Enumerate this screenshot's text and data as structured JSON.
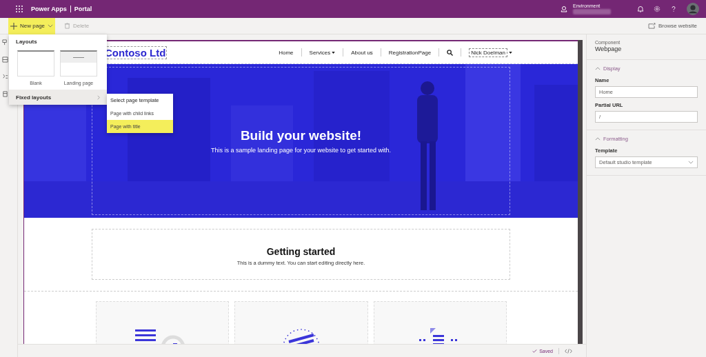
{
  "app_bar": {
    "title": "Power Apps",
    "section": "Portal",
    "environment_label": "Environment"
  },
  "toolbar": {
    "new_page": {
      "label": "New page",
      "highlighted": true
    },
    "delete": {
      "label": "Delete",
      "disabled": true
    },
    "browse": "Browse website"
  },
  "new_page_menu": {
    "layouts_title": "Layouts",
    "layouts": [
      {
        "label": "Blank",
        "kind": "blank"
      },
      {
        "label": "Landing page",
        "kind": "landing"
      }
    ],
    "fixed_layouts": {
      "label": "Fixed layouts",
      "expanded": true
    },
    "submenu": [
      {
        "label": "Select page template",
        "kind": "heading",
        "highlighted": false
      },
      {
        "label": "Page with child links",
        "kind": "item",
        "highlighted": false
      },
      {
        "label": "Page with title",
        "kind": "item",
        "highlighted": true
      }
    ]
  },
  "site": {
    "logo": "Contoso Ltd",
    "nav": [
      {
        "label": "Home",
        "kind": "link"
      },
      {
        "label": "Services",
        "kind": "dropdown"
      },
      {
        "label": "About us",
        "kind": "link"
      },
      {
        "label": "RegistrationPage",
        "kind": "link"
      },
      {
        "kind": "search"
      },
      {
        "label": "Nick Doelman",
        "kind": "user"
      }
    ],
    "hero": {
      "title": "Build your website!",
      "subtitle": "This is a sample landing page for your website to get started with."
    },
    "intro": {
      "title": "Getting started",
      "text": "This is a dummy text. You can start editing directly here."
    },
    "cards": [
      {
        "kind": "list"
      },
      {
        "kind": "spiral"
      },
      {
        "kind": "document"
      }
    ]
  },
  "properties": {
    "component_label": "Component",
    "component": "Webpage",
    "sections": [
      {
        "title": "Display",
        "expanded": true,
        "fields": [
          {
            "label": "Name",
            "value": "Home",
            "kind": "text"
          },
          {
            "label": "Partial URL",
            "value": "/",
            "kind": "text"
          }
        ]
      },
      {
        "title": "Formatting",
        "expanded": true,
        "fields": [
          {
            "label": "Template",
            "value": "Default studio template",
            "kind": "select"
          }
        ]
      }
    ]
  },
  "status_bar": {
    "status": "Saved"
  }
}
